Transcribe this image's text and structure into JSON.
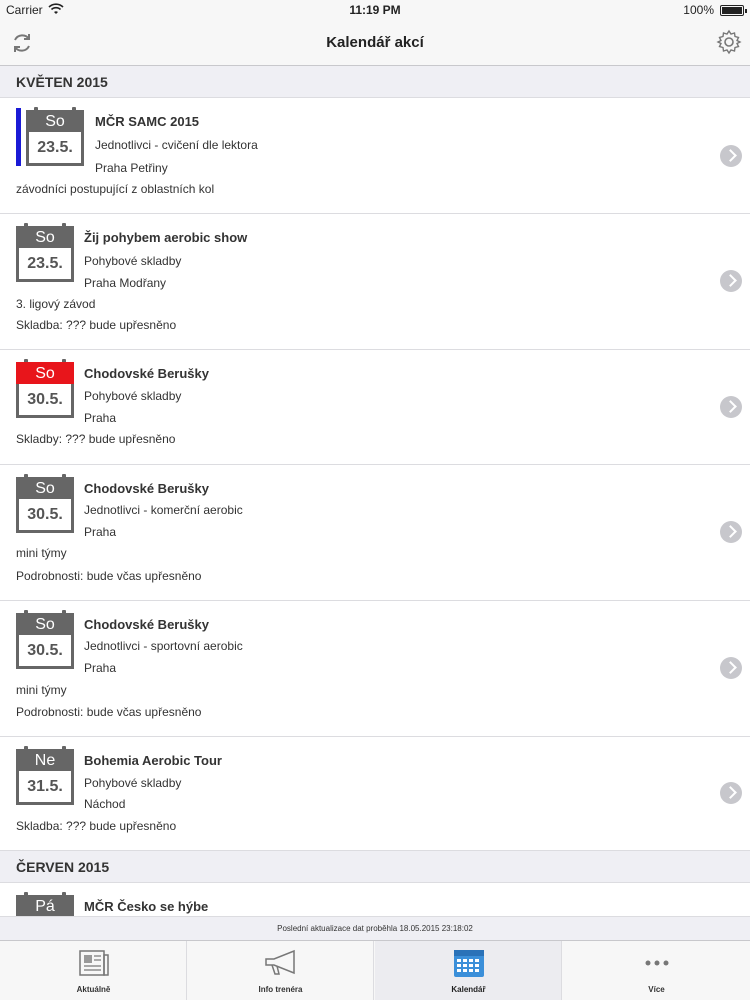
{
  "status": {
    "carrier": "Carrier",
    "time": "11:19 PM",
    "battery": "100%"
  },
  "nav": {
    "title": "Kalendář akcí",
    "left_icon": "refresh-icon",
    "right_icon": "gear-icon"
  },
  "sections": [
    {
      "title": "KVĚTEN 2015"
    },
    {
      "title": "ČERVEN 2015"
    }
  ],
  "events": [
    {
      "day": "So",
      "date": "23.5.",
      "title": "MČR SAMC 2015",
      "line1": "Jednotlivci - cvičení dle lektora",
      "line2": "Praha Petřiny",
      "note1": "závodníci postupující z oblastních kol",
      "note2": "",
      "accent": "#1a1ad6"
    },
    {
      "day": "So",
      "date": "23.5.",
      "title": "Žij pohybem aerobic show",
      "line1": "Pohybové skladby",
      "line2": "Praha Modřany",
      "note1": "3. ligový závod",
      "note2": "Skladba: ??? bude upřesněno"
    },
    {
      "day": "So",
      "date": "30.5.",
      "title": "Chodovské Berušky",
      "line1": "Pohybové skladby",
      "line2": "Praha",
      "note1": "Skladby: ??? bude upřesněno",
      "note2": "",
      "day_color": "#e8151b"
    },
    {
      "day": "So",
      "date": "30.5.",
      "title": "Chodovské Berušky",
      "line1": "Jednotlivci - komerční aerobic",
      "line2": "Praha",
      "note1": "mini týmy",
      "note2": "Podrobnosti: bude včas upřesněno"
    },
    {
      "day": "So",
      "date": "30.5.",
      "title": "Chodovské Berušky",
      "line1": "Jednotlivci - sportovní aerobic",
      "line2": "Praha",
      "note1": "mini týmy",
      "note2": "Podrobnosti: bude včas upřesněno"
    },
    {
      "day": "Ne",
      "date": "31.5.",
      "title": "Bohemia Aerobic Tour",
      "line1": "Pohybové skladby",
      "line2": "Náchod",
      "note1": "Skladba: ??? bude upřesněno",
      "note2": ""
    },
    {
      "day": "Pá",
      "date": "",
      "title": "MČR Česko se hýbe",
      "line1": "",
      "line2": "",
      "note1": "",
      "note2": ""
    }
  ],
  "footer": {
    "update_text": "Poslední aktualizace dat proběhla 18.05.2015 23:18:02"
  },
  "tabs": [
    {
      "label": "Aktuálně",
      "icon": "newspaper-icon"
    },
    {
      "label": "Info trenéra",
      "icon": "megaphone-icon"
    },
    {
      "label": "Kalendář",
      "icon": "calendar-icon",
      "active": true
    },
    {
      "label": "Více",
      "icon": "more-dots-icon"
    }
  ],
  "colors": {
    "accent_blue": "#1a1ad6",
    "highlight_red": "#e8151b",
    "tab_active": "#3b8fd9"
  }
}
